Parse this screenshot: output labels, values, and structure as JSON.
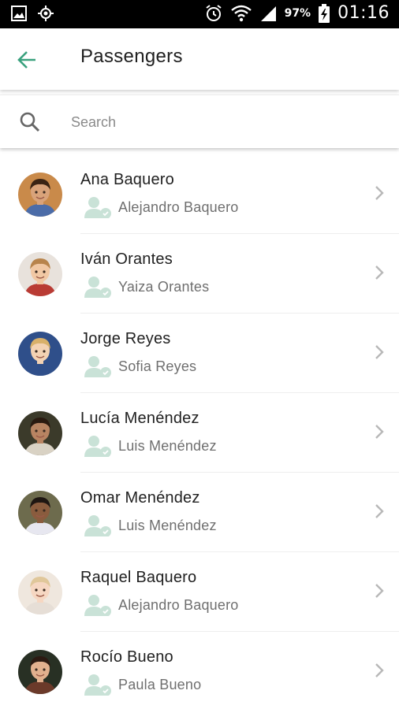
{
  "status_bar": {
    "battery_percent": "97%",
    "time": "01:16",
    "icons": [
      "gallery-icon",
      "location-target-icon",
      "alarm-icon",
      "wifi-icon",
      "signal-icon",
      "battery-charging-icon"
    ]
  },
  "app_bar": {
    "title": "Passengers",
    "back_icon": "arrow-left-icon",
    "accent_color": "#3aa17e"
  },
  "search": {
    "placeholder": "Search",
    "value": ""
  },
  "passengers": [
    {
      "name": "Ana Baquero",
      "guardian": "Alejandro Baquero",
      "avatar": "child-photo"
    },
    {
      "name": "Iván Orantes",
      "guardian": "Yaiza Orantes",
      "avatar": "child-photo"
    },
    {
      "name": "Jorge Reyes",
      "guardian": "Sofia Reyes",
      "avatar": "child-photo"
    },
    {
      "name": "Lucía Menéndez",
      "guardian": "Luis Menéndez",
      "avatar": "child-photo"
    },
    {
      "name": "Omar Menéndez",
      "guardian": "Luis Menéndez",
      "avatar": "child-photo"
    },
    {
      "name": "Raquel Baquero",
      "guardian": "Alejandro Baquero",
      "avatar": "child-photo"
    },
    {
      "name": "Rocío Bueno",
      "guardian": "Paula Bueno",
      "avatar": "child-photo"
    }
  ],
  "colors": {
    "guardian_icon": "#c9e2d7",
    "chevron": "#b8b8b8",
    "divider": "#eeeeee"
  }
}
